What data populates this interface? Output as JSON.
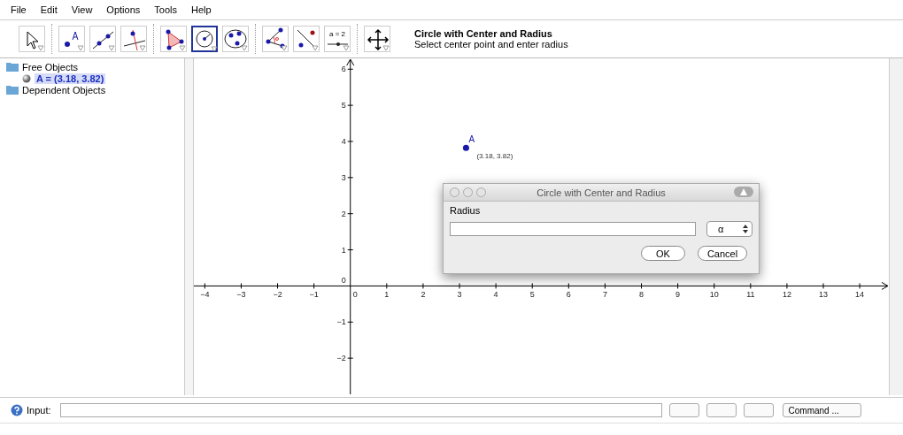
{
  "menu": [
    "File",
    "Edit",
    "View",
    "Options",
    "Tools",
    "Help"
  ],
  "toolbar": {
    "groups": [
      [
        {
          "kind": "move",
          "selected": false
        }
      ],
      [
        {
          "kind": "point",
          "selected": false
        },
        {
          "kind": "line",
          "selected": false
        },
        {
          "kind": "perpendicular",
          "selected": false
        }
      ],
      [
        {
          "kind": "polygon",
          "selected": false
        },
        {
          "kind": "circle",
          "selected": true
        },
        {
          "kind": "conic",
          "selected": false
        }
      ],
      [
        {
          "kind": "angle",
          "selected": false
        },
        {
          "kind": "reflect",
          "selected": false
        },
        {
          "kind": "slider",
          "selected": false,
          "label": "a = 2"
        }
      ],
      [
        {
          "kind": "move-view",
          "selected": false
        }
      ]
    ],
    "tool_title": "Circle with Center and Radius",
    "tool_help": "Select center point and enter radius"
  },
  "algebra": [
    {
      "label": "Free Objects",
      "children": [
        {
          "label": "A = (3.18, 3.82)",
          "selected": true
        }
      ]
    },
    {
      "label": "Dependent Objects"
    }
  ],
  "graphics": {
    "point_name": "A",
    "point_caption": "(3.18, 3.82)",
    "chart_data": {
      "type": "scatter",
      "x": [
        3.18
      ],
      "values": [
        3.82
      ],
      "xlim": [
        -4.3,
        14.8
      ],
      "ylim": [
        -3.0,
        6.3
      ],
      "xticks": [
        -4,
        -3,
        -2,
        -1,
        1,
        2,
        3,
        4,
        5,
        6,
        7,
        8,
        9,
        10,
        11,
        12,
        13,
        14
      ],
      "yticks": [
        -2,
        -1,
        1,
        2,
        3,
        4,
        5,
        6
      ]
    },
    "origin_labels": [
      "0",
      "0"
    ]
  },
  "dialog": {
    "title": "Circle with Center and Radius",
    "field_label": "Radius",
    "symbol_menu": "α",
    "buttons": [
      "OK",
      "Cancel"
    ]
  },
  "input_bar": {
    "label": "Input:",
    "command_menu": "Command ..."
  }
}
